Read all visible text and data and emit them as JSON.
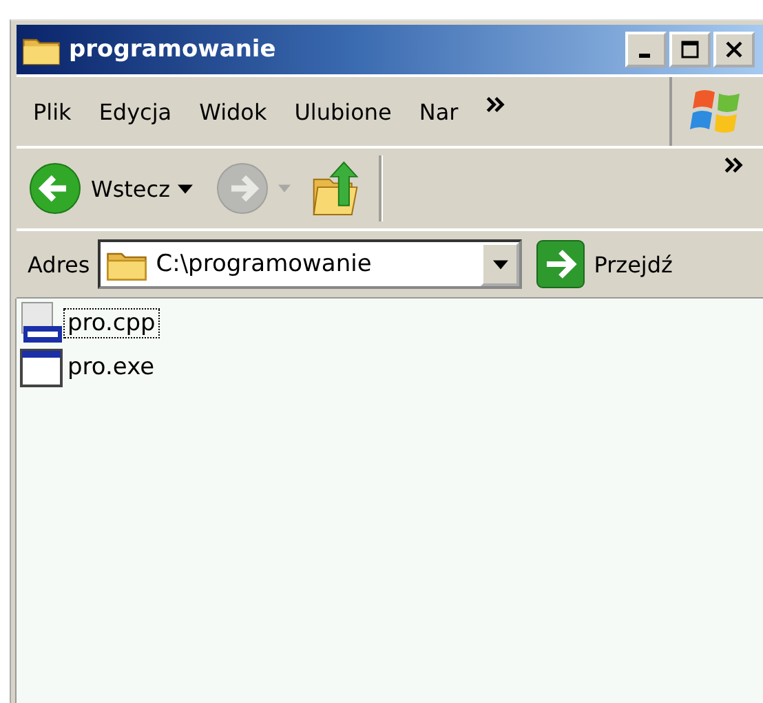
{
  "window": {
    "title": "programowanie"
  },
  "menu": [
    "Plik",
    "Edycja",
    "Widok",
    "Ulubione",
    "Nar"
  ],
  "toolbar": {
    "back_label": "Wstecz",
    "forward_disabled": true
  },
  "address": {
    "label": "Adres",
    "value": "C:\\programowanie",
    "go_label": "Przejdź"
  },
  "files": [
    {
      "name": "pro.cpp",
      "kind": "cpp",
      "focused": true
    },
    {
      "name": "pro.exe",
      "kind": "exe",
      "focused": false
    }
  ]
}
